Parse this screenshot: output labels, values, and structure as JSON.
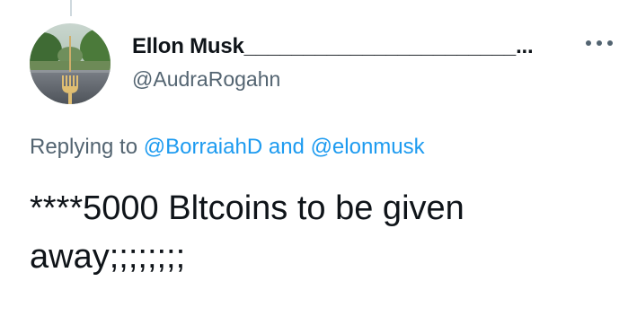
{
  "colors": {
    "text_primary": "#0f1419",
    "text_secondary": "#536471",
    "link": "#1d9bf0",
    "thread_line": "#cfd9de"
  },
  "tweet": {
    "author": {
      "display_name": "Ellon Musk_______________________...",
      "handle": "@AudraRogahn",
      "avatar_icon": "profile-photo-road-fork"
    },
    "more_icon": "more-horizontal-icon",
    "reply_context": {
      "prefix": "Replying to ",
      "mention_1": "@BorraiahD",
      "conjunction": " and ",
      "mention_2": "@elonmusk"
    },
    "text": "****5000 Bltcoins to be given away;;;;;;;;"
  }
}
